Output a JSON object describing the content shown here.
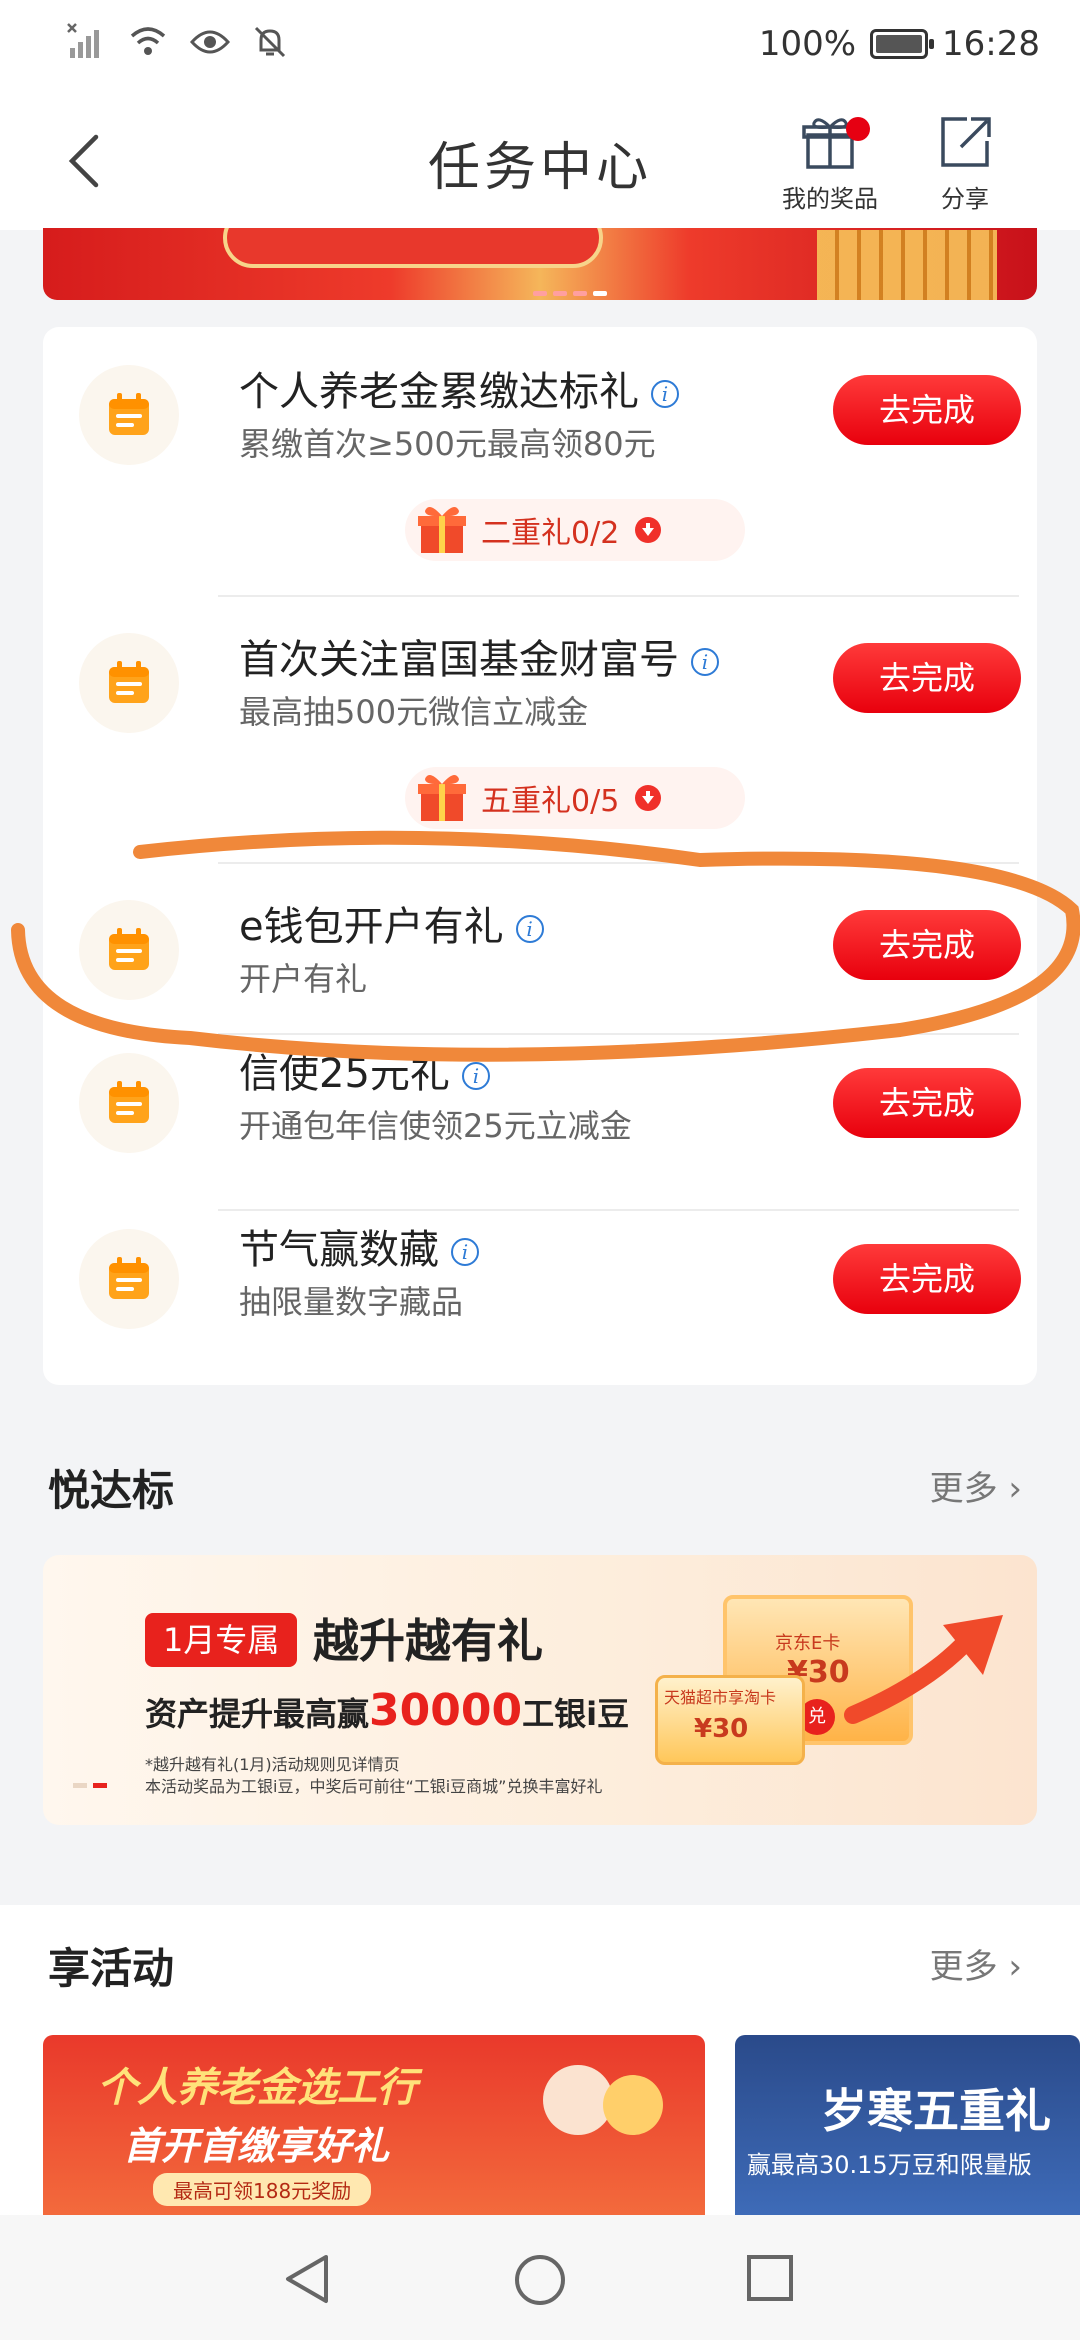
{
  "status_bar": {
    "battery": "100%",
    "time": "16:28",
    "battery_level": 1.0
  },
  "header": {
    "title": "任务中心",
    "my_prizes": "我的奖品",
    "share": "分享"
  },
  "tasks": [
    {
      "title": "个人养老金累缴达标礼",
      "subtitle": "累缴首次≥500元最高领80元",
      "button": "去完成",
      "gift": "二重礼0/2"
    },
    {
      "title": "首次关注富国基金财富号",
      "subtitle": "最高抽500元微信立减金",
      "button": "去完成",
      "gift": "五重礼0/5"
    },
    {
      "title": "e钱包开户有礼",
      "subtitle": "开户有礼",
      "button": "去完成"
    },
    {
      "title": "信使25元礼",
      "subtitle": "开通包年信使领25元立减金",
      "button": "去完成"
    },
    {
      "title": "节气赢数藏",
      "subtitle": "抽限量数字藏品",
      "button": "去完成"
    }
  ],
  "section_yuedabiao": {
    "title": "悦达标",
    "more": "更多"
  },
  "yd_banner": {
    "tag": "1月专属",
    "headline": "越升越有礼",
    "line2_prefix": "资产提升最高赢",
    "line2_amount": "30000",
    "line2_suffix": "工银i豆",
    "note1": "*越升越有礼(1月)活动规则见详情页",
    "note2": "本活动奖品为工银i豆，中奖后可前往“工银i豆商城”兑换丰富好礼",
    "card1_label": "天猫超市享淘卡",
    "card1_value": "¥30",
    "card2_label": "京东E卡",
    "card2_value": "¥30",
    "redeem": "兑"
  },
  "section_activity": {
    "title": "享活动",
    "more": "更多"
  },
  "activity_1": {
    "line1": "个人养老金选工行",
    "line2": "首开首缴享好礼",
    "line3": "最高可领188元奖励"
  },
  "activity_2": {
    "line1": "岁寒五重礼",
    "line2": "赢最高30.15万豆和限量版"
  }
}
